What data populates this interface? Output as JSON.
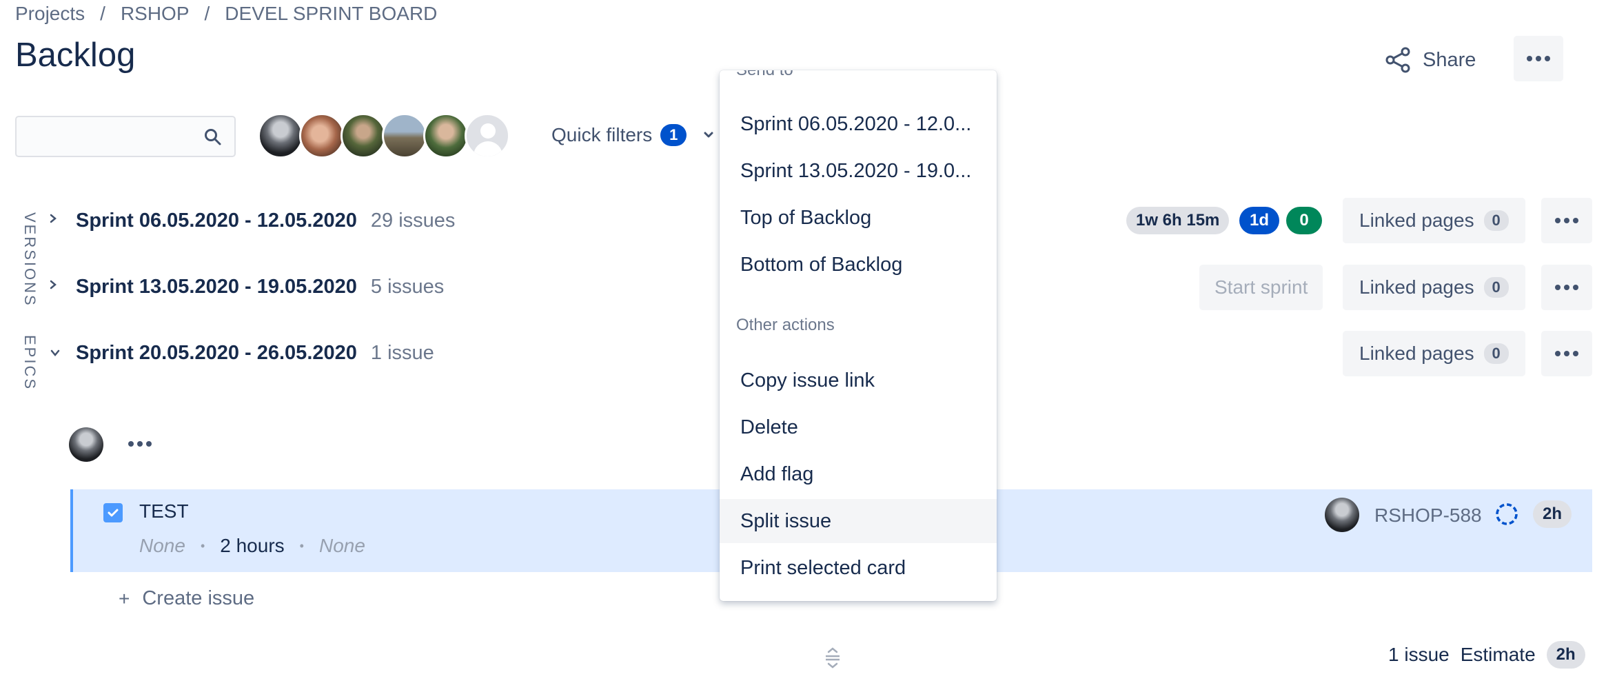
{
  "breadcrumb": {
    "items": [
      "Projects",
      "RSHOP",
      "DEVEL SPRINT BOARD"
    ],
    "separator": "/"
  },
  "page_title": "Backlog",
  "header": {
    "share_label": "Share"
  },
  "search": {
    "value": "",
    "placeholder": ""
  },
  "quick_filters": {
    "label": "Quick filters",
    "count": "1"
  },
  "side_tabs": {
    "versions": "VERSIONS",
    "epics": "EPICS"
  },
  "sprints": [
    {
      "name": "Sprint 06.05.2020 - 12.05.2020",
      "issue_count": "29 issues",
      "expanded": false,
      "estimates": {
        "time": "1w 6h 15m",
        "in_progress": "1d",
        "done": "0"
      },
      "linked_pages_label": "Linked pages",
      "linked_pages_count": "0"
    },
    {
      "name": "Sprint 13.05.2020 - 19.05.2020",
      "issue_count": "5 issues",
      "expanded": false,
      "start_sprint_label": "Start sprint",
      "linked_pages_label": "Linked pages",
      "linked_pages_count": "0"
    },
    {
      "name": "Sprint 20.05.2020 - 26.05.2020",
      "issue_count": "1 issue",
      "expanded": true,
      "linked_pages_label": "Linked pages",
      "linked_pages_count": "0"
    }
  ],
  "issue": {
    "summary": "TEST",
    "epic": "None",
    "original_estimate": "2 hours",
    "version": "None",
    "key": "RSHOP-588",
    "estimate": "2h",
    "checked": true
  },
  "create_issue_label": "Create issue",
  "footer": {
    "issue_count": "1 issue",
    "estimate_label": "Estimate",
    "estimate_value": "2h"
  },
  "context_menu": {
    "send_to_heading": "Send to",
    "send_to_items": [
      "Sprint 06.05.2020 - 12.0...",
      "Sprint 13.05.2020 - 19.0...",
      "Top of Backlog",
      "Bottom of Backlog"
    ],
    "other_heading": "Other actions",
    "other_items": [
      "Copy issue link",
      "Delete",
      "Add flag",
      "Split issue",
      "Print selected card"
    ],
    "hovered_item": "Split issue"
  },
  "colors": {
    "accent": "#0052cc",
    "done_green": "#00875a",
    "selected_row": "#deebff",
    "text_primary": "#172b4d",
    "text_subtle": "#5e6c84"
  }
}
